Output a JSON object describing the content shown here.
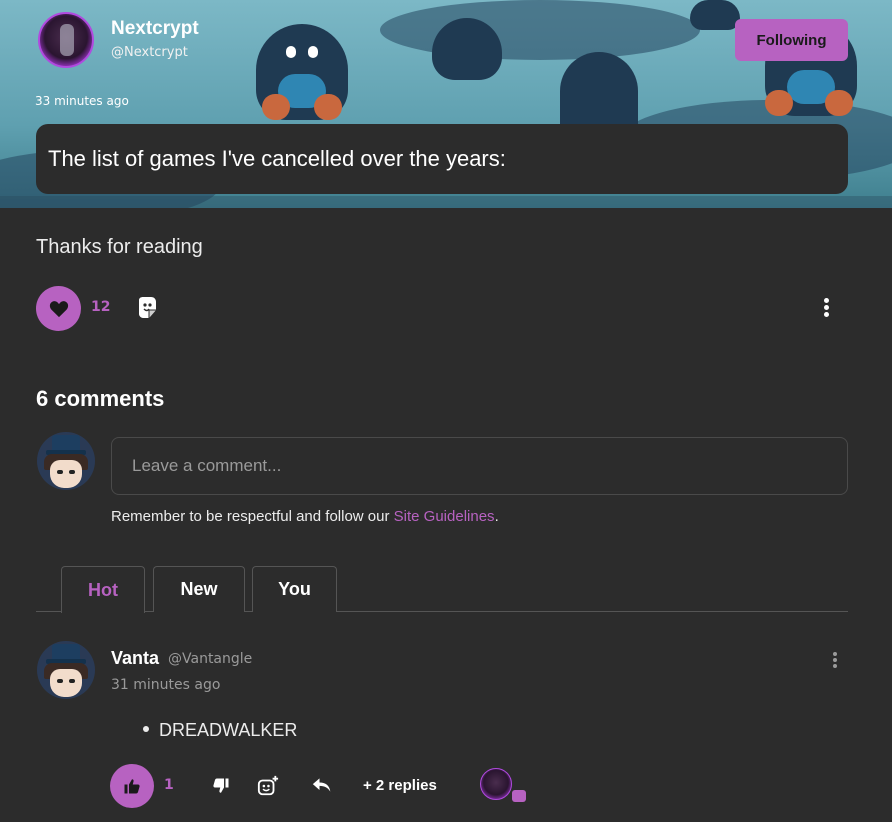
{
  "post": {
    "author_name": "Nextcrypt",
    "author_handle": "@Nextcrypt",
    "follow_label": "Following",
    "timestamp": "33 minutes ago",
    "title": "The list of games I've cancelled over the years:",
    "body": "Thanks for reading",
    "like_count": "12"
  },
  "comments_section": {
    "heading": "6 comments",
    "input_placeholder": "Leave a comment...",
    "guidelines_prefix": "Remember to be respectful and follow our ",
    "guidelines_link": "Site Guidelines",
    "guidelines_suffix": ".",
    "tabs": [
      {
        "label": "Hot",
        "active": true
      },
      {
        "label": "New",
        "active": false
      },
      {
        "label": "You",
        "active": false
      }
    ]
  },
  "comments": [
    {
      "name": "Vanta",
      "handle": "@Vantangle",
      "time": "31 minutes ago",
      "list_items": [
        "DREADWALKER"
      ],
      "like_count": "1",
      "replies_label": "+ 2 replies"
    }
  ],
  "colors": {
    "accent": "#b762c1",
    "background": "#2c2c2c"
  },
  "icons": [
    "heart-icon",
    "sticker-react-icon",
    "more-vertical-icon",
    "thumbs-up-icon",
    "thumbs-down-icon",
    "add-reaction-icon",
    "reply-arrow-icon"
  ]
}
